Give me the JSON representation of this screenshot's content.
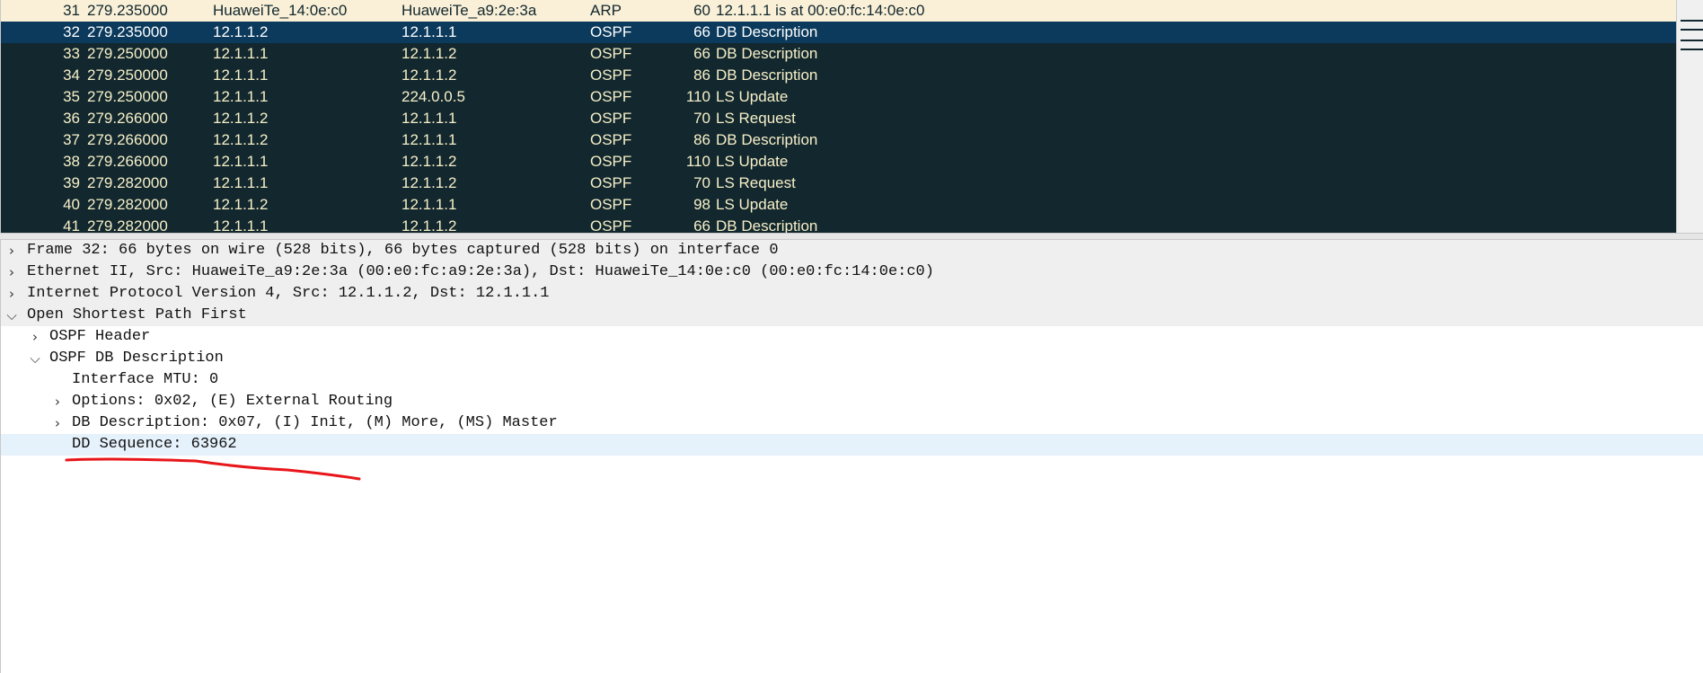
{
  "packet_list": {
    "rows": [
      {
        "no": "31",
        "time": "279.235000",
        "source": "HuaweiTe_14:0e:c0",
        "destination": "HuaweiTe_a9:2e:3a",
        "protocol": "ARP",
        "length": "60",
        "info": "12.1.1.1 is at 00:e0:fc:14:0e:c0"
      },
      {
        "no": "32",
        "time": "279.235000",
        "source": "12.1.1.2",
        "destination": "12.1.1.1",
        "protocol": "OSPF",
        "length": "66",
        "info": "DB Description"
      },
      {
        "no": "33",
        "time": "279.250000",
        "source": "12.1.1.1",
        "destination": "12.1.1.2",
        "protocol": "OSPF",
        "length": "66",
        "info": "DB Description"
      },
      {
        "no": "34",
        "time": "279.250000",
        "source": "12.1.1.1",
        "destination": "12.1.1.2",
        "protocol": "OSPF",
        "length": "86",
        "info": "DB Description"
      },
      {
        "no": "35",
        "time": "279.250000",
        "source": "12.1.1.1",
        "destination": "224.0.0.5",
        "protocol": "OSPF",
        "length": "110",
        "info": "LS Update"
      },
      {
        "no": "36",
        "time": "279.266000",
        "source": "12.1.1.2",
        "destination": "12.1.1.1",
        "protocol": "OSPF",
        "length": "70",
        "info": "LS Request"
      },
      {
        "no": "37",
        "time": "279.266000",
        "source": "12.1.1.2",
        "destination": "12.1.1.1",
        "protocol": "OSPF",
        "length": "86",
        "info": "DB Description"
      },
      {
        "no": "38",
        "time": "279.266000",
        "source": "12.1.1.1",
        "destination": "12.1.1.2",
        "protocol": "OSPF",
        "length": "110",
        "info": "LS Update"
      },
      {
        "no": "39",
        "time": "279.282000",
        "source": "12.1.1.1",
        "destination": "12.1.1.2",
        "protocol": "OSPF",
        "length": "70",
        "info": "LS Request"
      },
      {
        "no": "40",
        "time": "279.282000",
        "source": "12.1.1.2",
        "destination": "12.1.1.1",
        "protocol": "OSPF",
        "length": "98",
        "info": "LS Update"
      },
      {
        "no": "41",
        "time": "279.282000",
        "source": "12.1.1.1",
        "destination": "12.1.1.2",
        "protocol": "OSPF",
        "length": "66",
        "info": "DB Description"
      }
    ]
  },
  "details": {
    "frame": "Frame 32: 66 bytes on wire (528 bits), 66 bytes captured (528 bits) on interface 0",
    "ethernet": "Ethernet II, Src: HuaweiTe_a9:2e:3a (00:e0:fc:a9:2e:3a), Dst: HuaweiTe_14:0e:c0 (00:e0:fc:14:0e:c0)",
    "ip": "Internet Protocol Version 4, Src: 12.1.1.2, Dst: 12.1.1.1",
    "ospf": "Open Shortest Path First",
    "ospf_header": "OSPF Header",
    "ospf_db_description": "OSPF DB Description",
    "interface_mtu": "Interface MTU: 0",
    "options": "Options: 0x02, (E) External Routing",
    "db_description_flags": "DB Description: 0x07, (I) Init, (M) More, (MS) Master",
    "dd_sequence": "DD Sequence: 63962"
  },
  "icons": {
    "collapsed": "chevron-right-icon",
    "expanded": "chevron-down-icon"
  },
  "colors": {
    "arp_row": "#faf0d7",
    "ospf_row": "#12272e",
    "selected_row": "#0b3a5c",
    "highlight_row": "#e5f1fb",
    "annotation": "#e8161b"
  }
}
